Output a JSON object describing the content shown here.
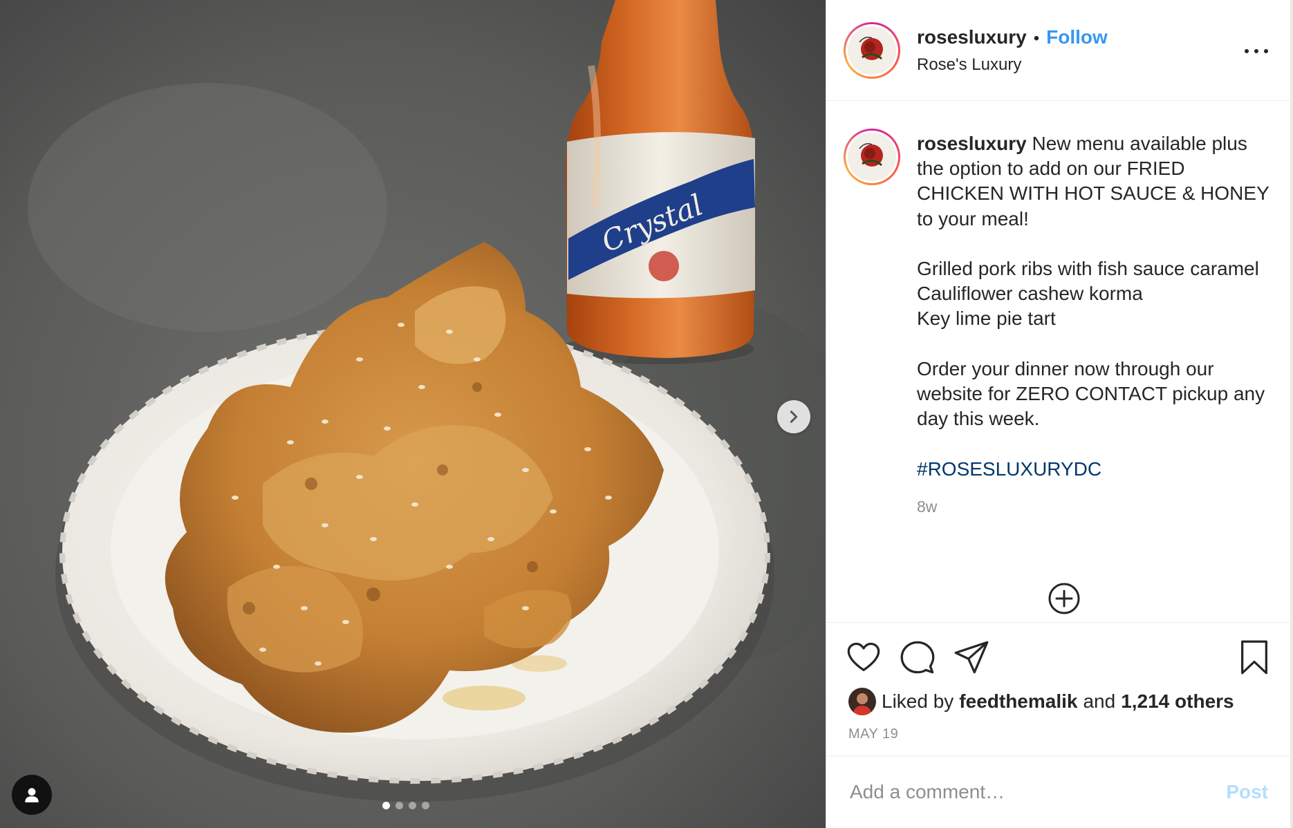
{
  "colors": {
    "follow": "#3897f0",
    "hashtag": "#00376b",
    "text": "#262626",
    "muted": "#8e8e8e",
    "post_disabled": "#b2dffc"
  },
  "header": {
    "username": "rosesluxury",
    "separator": "•",
    "follow_label": "Follow",
    "location": "Rose's Luxury",
    "more_icon": "more-horizontal-icon"
  },
  "caption": {
    "username": "rosesluxury",
    "lines": [
      "New menu available plus the option to add on our FRIED CHICKEN WITH HOT SAUCE & HONEY to your meal!",
      "Grilled pork ribs with fish sauce caramel",
      "Cauliflower cashew korma",
      "Key lime pie tart",
      "Order your dinner now through our website for ZERO CONTACT pickup any day this week."
    ],
    "hashtag": "#ROSESLUXURYDC",
    "time_ago": "8w"
  },
  "actions": {
    "icons": [
      "heart-icon",
      "comment-icon",
      "share-icon",
      "bookmark-icon"
    ]
  },
  "likes": {
    "prefix": "Liked by",
    "liker": "feedthemalik",
    "joiner": "and",
    "others": "1,214 others"
  },
  "date": "MAY 19",
  "comment": {
    "placeholder": "Add a comment…",
    "post_label": "Post"
  },
  "carousel": {
    "slide_count": 4,
    "active_slide": 1
  }
}
